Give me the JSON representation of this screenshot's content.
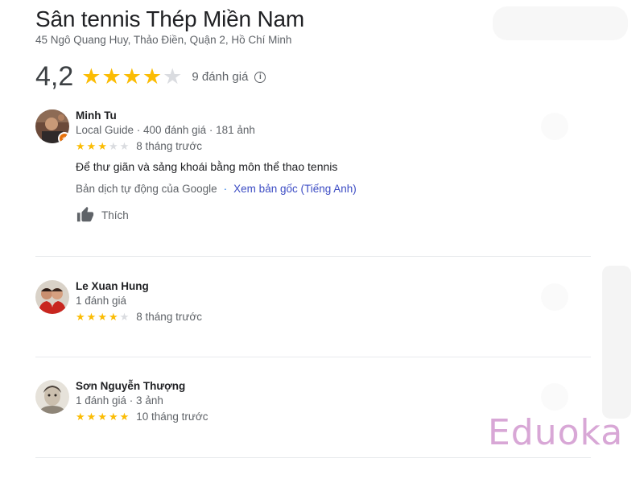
{
  "place": {
    "title": "Sân tennis Thép Miền Nam",
    "address": "45 Ngô Quang Huy, Thảo Điền, Quận 2, Hồ Chí Minh"
  },
  "rating_summary": {
    "score": "4,2",
    "stars": 4,
    "review_count": "9 đánh giá",
    "info_icon": "info-icon"
  },
  "reviews": [
    {
      "name": "Minh Tu",
      "meta": "Local Guide · 400 đánh giá · 181 ảnh",
      "stars": 3,
      "time": "8 tháng trước",
      "text": "Để thư giãn và sảng khoái bằng môn thể thao tennis",
      "translation_note": "Bản dịch tự động của Google",
      "separator": "·",
      "original_link": "Xem bản gốc (Tiếng Anh)",
      "like_label": "Thích"
    },
    {
      "name": "Le Xuan Hung",
      "meta": "1 đánh giá",
      "stars": 4,
      "time": "8 tháng trước"
    },
    {
      "name": "Sơn Nguyễn Thượng",
      "meta": "1 đánh giá · 3 ảnh",
      "stars": 5,
      "time": "10 tháng trước"
    }
  ],
  "watermark": "Eduoka",
  "colors": {
    "star_filled": "#fbbc04",
    "star_empty": "#dadce0",
    "link": "#3c4cc4",
    "local_guide_badge": "#e8710a",
    "watermark": "#d8a7d6"
  }
}
